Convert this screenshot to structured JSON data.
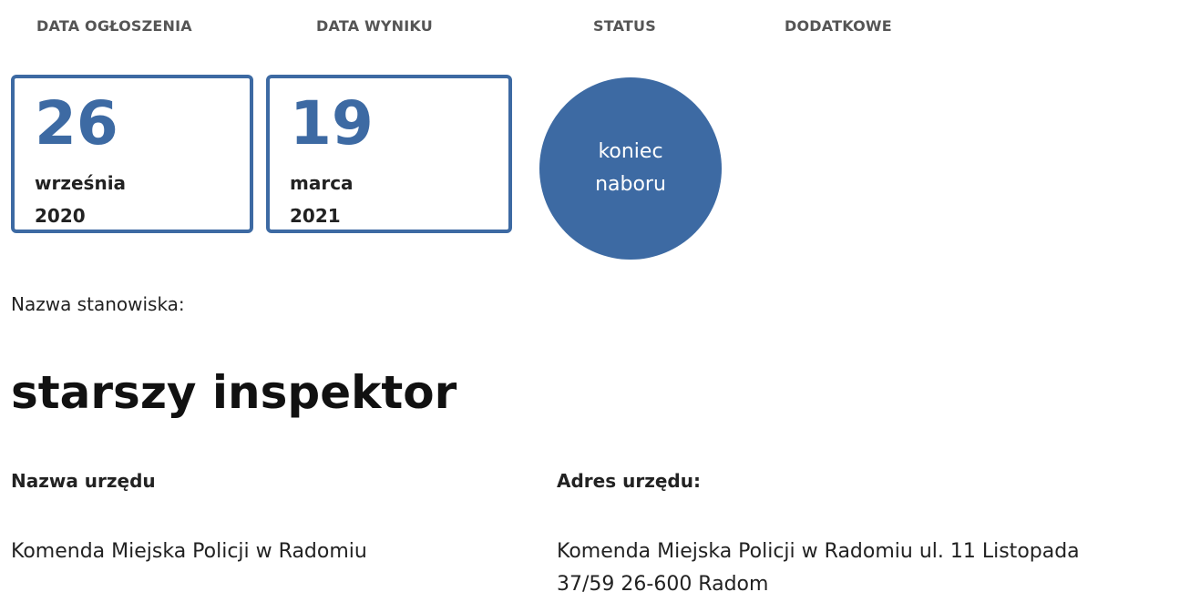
{
  "headers": {
    "announcement_date": "DATA OGŁOSZENIA",
    "result_date": "DATA WYNIKU",
    "status": "STATUS",
    "additional": "DODATKOWE"
  },
  "announcement_date": {
    "day": "26",
    "month": "września",
    "year": "2020"
  },
  "result_date": {
    "day": "19",
    "month": "marca",
    "year": "2021"
  },
  "status": {
    "line1": "koniec",
    "line2": "naboru"
  },
  "position": {
    "label": "Nazwa stanowiska:",
    "title": "starszy inspektor"
  },
  "office": {
    "name_heading": "Nazwa urzędu",
    "name_value": "Komenda Miejska Policji w Radomiu",
    "address_heading": "Adres urzędu:",
    "address_line1": "Komenda Miejska Policji w Radomiu ul. 11 Listopada",
    "address_line2": "37/59 26-600 Radom"
  },
  "colors": {
    "accent": "#3d6aa3",
    "header_text": "#555555"
  }
}
